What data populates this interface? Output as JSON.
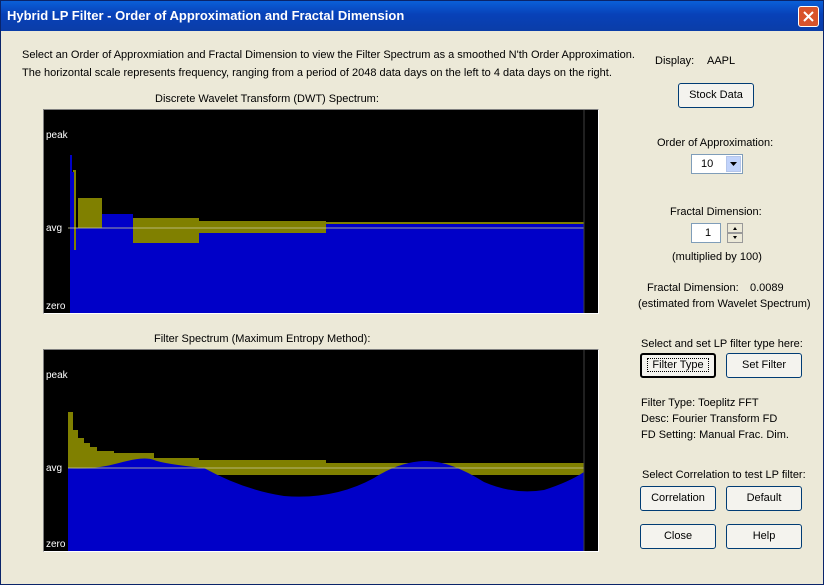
{
  "window": {
    "title": "Hybrid LP Filter - Order of Approximation and Fractal Dimension"
  },
  "intro": {
    "line1": "Select an Order of Approxmiation and Fractal Dimension to view the Filter Spectrum as a smoothed N'th Order Approximation.",
    "line2": "The horizontal scale represents frequency, ranging from a period of 2048 data days on the left to 4 data days on the right."
  },
  "dwt_panel": {
    "caption": "Discrete Wavelet Transform (DWT) Spectrum:",
    "labels": {
      "peak": "peak",
      "avg": "avg",
      "zero": "zero"
    }
  },
  "mem_panel": {
    "caption": "Filter Spectrum (Maximum Entropy Method):",
    "labels": {
      "peak": "peak",
      "avg": "avg",
      "zero": "zero"
    }
  },
  "display": {
    "label": "Display:",
    "value": "AAPL"
  },
  "buttons": {
    "stock_data": "Stock Data",
    "filter_type": "Filter Type",
    "set_filter": "Set Filter",
    "correlation": "Correlation",
    "default": "Default",
    "close": "Close",
    "help": "Help"
  },
  "order": {
    "label": "Order of Approximation:",
    "value": "10"
  },
  "fractal": {
    "label": "Fractal Dimension:",
    "value": "1",
    "note": "(multiplied by 100)",
    "estimate_label": "Fractal Dimension:",
    "estimate_value": "0.0089",
    "estimate_note": "(estimated from Wavelet Spectrum)"
  },
  "lp_filter": {
    "prompt": "Select and set LP filter type here:",
    "type_line": "Filter Type:  Toeplitz FFT",
    "desc_line": "Desc:  Fourier Transform FD",
    "fd_line": "FD Setting:  Manual Frac. Dim."
  },
  "correlation": {
    "prompt": "Select Correlation to test LP filter:"
  },
  "colors": {
    "plot_bg": "#000000",
    "spectrum_blue": "#0000c8",
    "olive_bars": "#808000",
    "avg_line": "#c8c896"
  }
}
